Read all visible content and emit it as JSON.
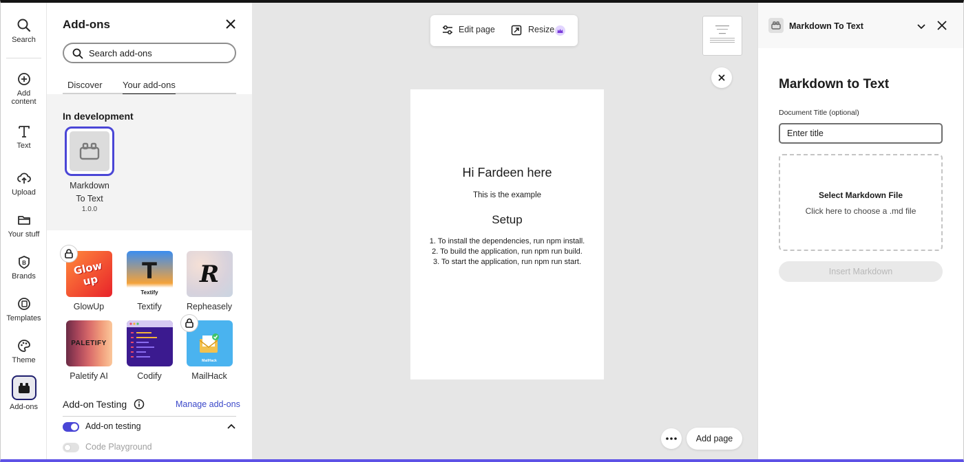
{
  "rail": {
    "items": [
      {
        "label": "Search",
        "icon": "search-icon"
      },
      {
        "label": "Add\ncontent",
        "icon": "plus-circle-icon"
      },
      {
        "label": "Text",
        "icon": "text-icon"
      },
      {
        "label": "Upload",
        "icon": "upload-cloud-icon"
      },
      {
        "label": "Your stuff",
        "icon": "folder-icon"
      },
      {
        "label": "Brands",
        "icon": "brand-icon"
      },
      {
        "label": "Templates",
        "icon": "templates-icon"
      },
      {
        "label": "Theme",
        "icon": "palette-icon"
      },
      {
        "label": "Add-ons",
        "icon": "addons-icon"
      }
    ],
    "add_line1": "Add",
    "add_line2": "content"
  },
  "addons_panel": {
    "title": "Add-ons",
    "search_placeholder": "Search add-ons",
    "tabs": [
      "Discover",
      "Your add-ons"
    ],
    "active_tab": "Your add-ons",
    "in_development": {
      "title": "In development",
      "item": {
        "name_line1": "Markdown",
        "name_line2": "To Text",
        "version": "1.0.0"
      }
    },
    "addons": [
      {
        "name": "GlowUp",
        "locked": true
      },
      {
        "name": "Textify",
        "locked": false
      },
      {
        "name": "Repheasely",
        "locked": false
      },
      {
        "name": "Paletify AI",
        "locked": false
      },
      {
        "name": "Codify",
        "locked": false
      },
      {
        "name": "MailHack",
        "locked": true
      }
    ],
    "thumb_text": {
      "glowup": "Glow up",
      "textify_letter": "T",
      "textify_word": "Textify",
      "repheasely_letter": "R",
      "paletify": "PALETIFY",
      "mailhack": "MailHack"
    },
    "testing": {
      "title": "Add-on Testing",
      "manage_link": "Manage add-ons",
      "toggle1": {
        "label": "Add-on testing",
        "on": true
      },
      "toggle2": {
        "label": "Code Playground",
        "on": false
      }
    }
  },
  "canvas": {
    "toolbar": {
      "edit_page": "Edit page",
      "resize": "Resize"
    },
    "page": {
      "heading": "Hi Fardeen here",
      "subtitle": "This is the example",
      "section": "Setup",
      "steps": [
        "1. To install the dependencies, run npm install.",
        "2. To build the application, run npm run build.",
        "3. To start the application, run npm run start."
      ]
    },
    "add_page": "Add page"
  },
  "right_panel": {
    "header_title": "Markdown To Text",
    "title": "Markdown to Text",
    "field_label": "Document Title (optional)",
    "field_placeholder": "Enter title",
    "drop_title": "Select Markdown File",
    "drop_sub": "Click here to choose a .md file",
    "insert_button": "Insert Markdown"
  },
  "colors": {
    "accent": "#4a46d6",
    "link": "#3b48c9",
    "canvas_bg": "#e6e6e6",
    "bottom_bar": "#5e52e6"
  }
}
